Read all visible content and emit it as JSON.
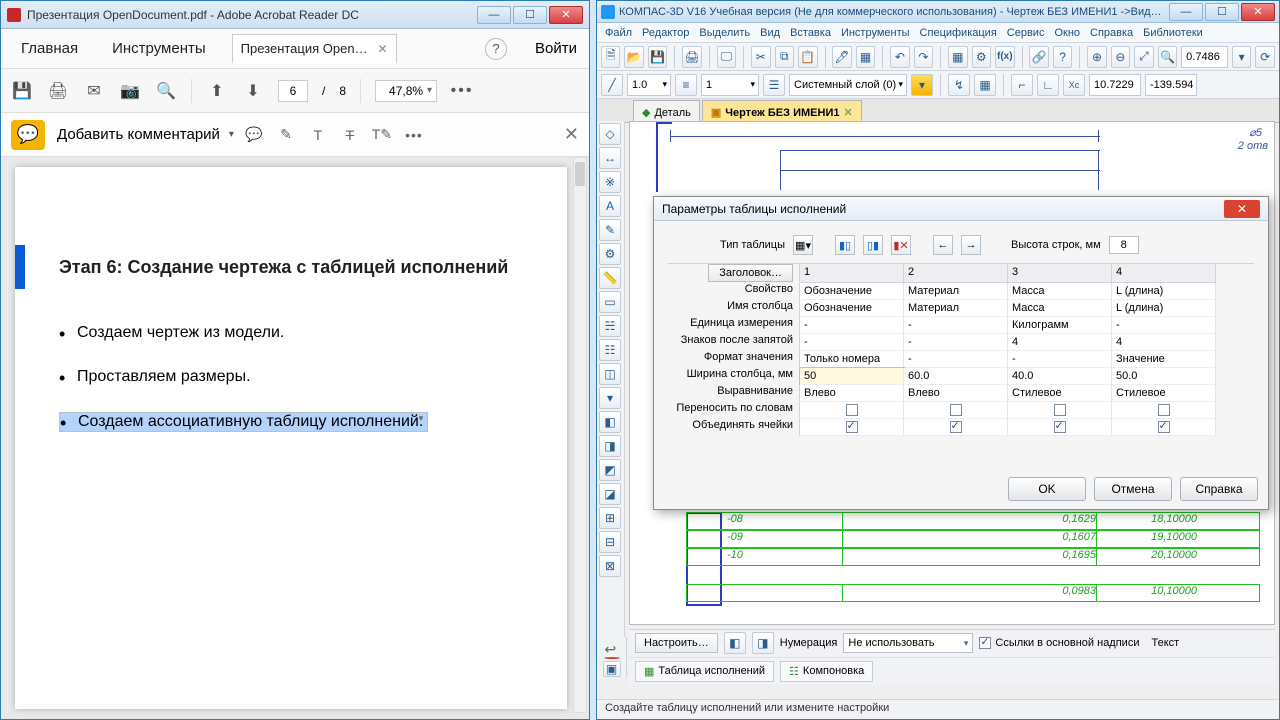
{
  "left": {
    "title": "Презентация OpenDocument.pdf - Adobe Acrobat Reader DC",
    "tabs": {
      "home": "Главная",
      "tools": "Инструменты",
      "file": "Презентация Open…"
    },
    "help": "?",
    "signin": "Войти",
    "page_cur": "6",
    "page_sep": "/",
    "page_total": "8",
    "zoom": "47,8%",
    "comment": "Добавить комментарий",
    "pdf": {
      "heading": "Этап 6: Создание чертежа с таблицей исполнений",
      "li1": "Создаем чертеж из модели.",
      "li2": "Проставляем размеры.",
      "li3": "Создаем ассоциативную таблицу исполнений."
    }
  },
  "right": {
    "title": "КОМПАС-3D V16 Учебная версия (Не для коммерческого использования) - Чертеж БЕЗ ИМЕНИ1 ->Вид…",
    "menu": [
      "Файл",
      "Редактор",
      "Выделить",
      "Вид",
      "Вставка",
      "Инструменты",
      "Спецификация",
      "Сервис",
      "Окно",
      "Справка",
      "Библиотеки"
    ],
    "scale": "0.7486",
    "lw": "1.0",
    "layer_no": "1",
    "layer_name": "Системный слой (0)",
    "coordX": "10.7229",
    "coordY": "-139.594",
    "doctabs": {
      "t1": "Деталь",
      "t2": "Чертеж БЕЗ ИМЕНИ1"
    },
    "drawing": {
      "dim_label": "2 отв",
      "dia": "⌀5"
    },
    "green_rows": {
      "r1": {
        "c1": "-08",
        "c2": "0,1629",
        "c3": "18,10000"
      },
      "r2": {
        "c1": "-09",
        "c2": "0,1607",
        "c3": "19,10000"
      },
      "r3": {
        "c1": "-10",
        "c2": "0,1695",
        "c3": "20,10000"
      },
      "r4": {
        "c1": "",
        "c2": "0,0983",
        "c3": "10,10000"
      }
    },
    "prop": {
      "config": "Настроить…",
      "num_label": "Нумерация",
      "num_sel": "Не использовать",
      "chk": "Ссылки в основной надписи",
      "text": "Текст",
      "tab1": "Таблица исполнений",
      "tab2": "Компоновка"
    },
    "status": "Создайте таблицу исполнений или измените настройки"
  },
  "dlg": {
    "title": "Параметры таблицы исполнений",
    "type_label": "Тип таблицы",
    "rowh_label": "Высота строк, мм",
    "rowh": "8",
    "header_btn": "Заголовок…",
    "cols": {
      "c1": "1",
      "c2": "2",
      "c3": "3",
      "c4": "4"
    },
    "rows": {
      "r1": "Свойство",
      "r2": "Имя столбца",
      "r3": "Единица измерения",
      "r4": "Знаков после запятой",
      "r5": "Формат значения",
      "r6": "Ширина столбца, мм",
      "r7": "Выравнивание",
      "r8": "Переносить по словам",
      "r9": "Объединять ячейки"
    },
    "d": {
      "r1": {
        "c1": "Обозначение",
        "c2": "Материал",
        "c3": "Масса",
        "c4": "L (длина)"
      },
      "r2": {
        "c1": "Обозначение",
        "c2": "Материал",
        "c3": "Масса",
        "c4": "L (длина)"
      },
      "r3": {
        "c1": "-",
        "c2": "-",
        "c3": "Килограмм",
        "c4": "-"
      },
      "r4": {
        "c1": "-",
        "c2": "-",
        "c3": "4",
        "c4": "4"
      },
      "r5": {
        "c1": "Только номера исп…",
        "c2": "-",
        "c3": "-",
        "c4": "Значение"
      },
      "r6": {
        "c1": "50",
        "c2": "60.0",
        "c3": "40.0",
        "c4": "50.0"
      },
      "r7": {
        "c1": "Влево",
        "c2": "Влево",
        "c3": "Стилевое",
        "c4": "Стилевое"
      }
    },
    "ok": "OK",
    "cancel": "Отмена",
    "helpb": "Справка"
  }
}
